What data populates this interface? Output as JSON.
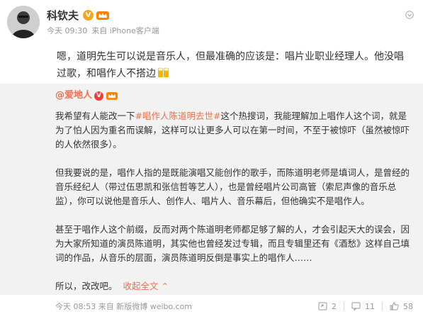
{
  "author": {
    "name": "科钦夫",
    "badge": "V",
    "meta_time": "今天 09:30",
    "meta_from": "来自 iPhone客户端"
  },
  "post": {
    "text": "嗯，道明先生可以说是音乐人，但最准确的应该是：唱片业职业经理人。他没唱过歌，和唱作人不搭边"
  },
  "repost": {
    "author": "@爱地人",
    "badge": "V",
    "p1_before": "我希望有人能改一下",
    "p1_hashtag": "#唱作人陈道明去世#",
    "p1_after": "这个热搜词，我能理解加上唱作人这个词，就是为了怕人因为重名而误解，这样可以让更多人可以在第一时间，不至于被惊吓（虽然被惊吓的人依然很多）。",
    "p2": "但我要说的是，唱作人指的是既能演唱又能创作的歌手，而陈道明老师是填词人，是曾经的音乐经纪人（带过伍思凯和张信哲等艺人），也是曾经唱片公司高管（索尼声像的音乐总监），你可以说他是音乐人、创作人、唱片人、音乐幕后，但他确实不是唱作人。",
    "p3": "甚至于唱作人这个前缀，反而对两个陈道明老师都足够了解的人，才会引起天大的误会，因为大家所知道的演员陈道明，其实他也曾经发过专辑，而且专辑里还有《酒愁》这样自己填词的作品，从音乐的层面，演员陈道明反倒是事实上的唱作人……",
    "p4": "所以，改改吧。",
    "collapse_label": "收起全文",
    "collapse_arrow": "⌃"
  },
  "footer": {
    "time": "今天 08:53",
    "from": "来自 新版微博 weibo.com",
    "repost_count": "2",
    "comment_count": "11",
    "like_count": "58"
  },
  "colors": {
    "link": "#eb7350",
    "repost_bg": "#f2f2f2",
    "meta": "#999999",
    "badge_gold": "#f5a623",
    "badge_red": "#f23d3d"
  }
}
